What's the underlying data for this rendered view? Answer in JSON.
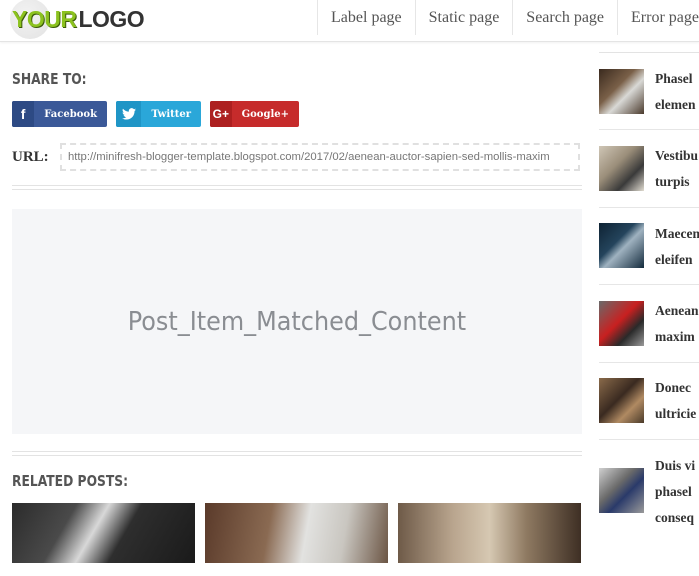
{
  "header": {
    "logo_your": "YOUR",
    "logo_logo": "LOGO",
    "nav": [
      "Label page",
      "Static page",
      "Search page",
      "Error page"
    ]
  },
  "share": {
    "title": "SHARE TO:",
    "facebook": "Facebook",
    "twitter": "Twitter",
    "googleplus": "Google+",
    "facebook_icon": "f",
    "googleplus_icon": "G+"
  },
  "url": {
    "label": "URL:",
    "value": "http://minifresh-blogger-template.blogspot.com/2017/02/aenean-auctor-sapien-sed-mollis-maxim"
  },
  "matched_content": "Post_Item_Matched_Content",
  "related": {
    "title": "RELATED POSTS:"
  },
  "sidebar": {
    "items": [
      {
        "line1": "Phasel",
        "line2": "elemen"
      },
      {
        "line1": "Vestibu",
        "line2": "turpis"
      },
      {
        "line1": "Maecen",
        "line2": "eleifen"
      },
      {
        "line1": "Aenean",
        "line2": "maxim"
      },
      {
        "line1": "Donec",
        "line2": "ultricie"
      },
      {
        "line1": "Duis vi",
        "line2": "phasel",
        "line3": "conseq"
      }
    ]
  },
  "colors": {
    "accent": "#8cc21f",
    "facebook": "#3b5998",
    "twitter": "#2aa7d9",
    "googleplus": "#c62b2b"
  }
}
